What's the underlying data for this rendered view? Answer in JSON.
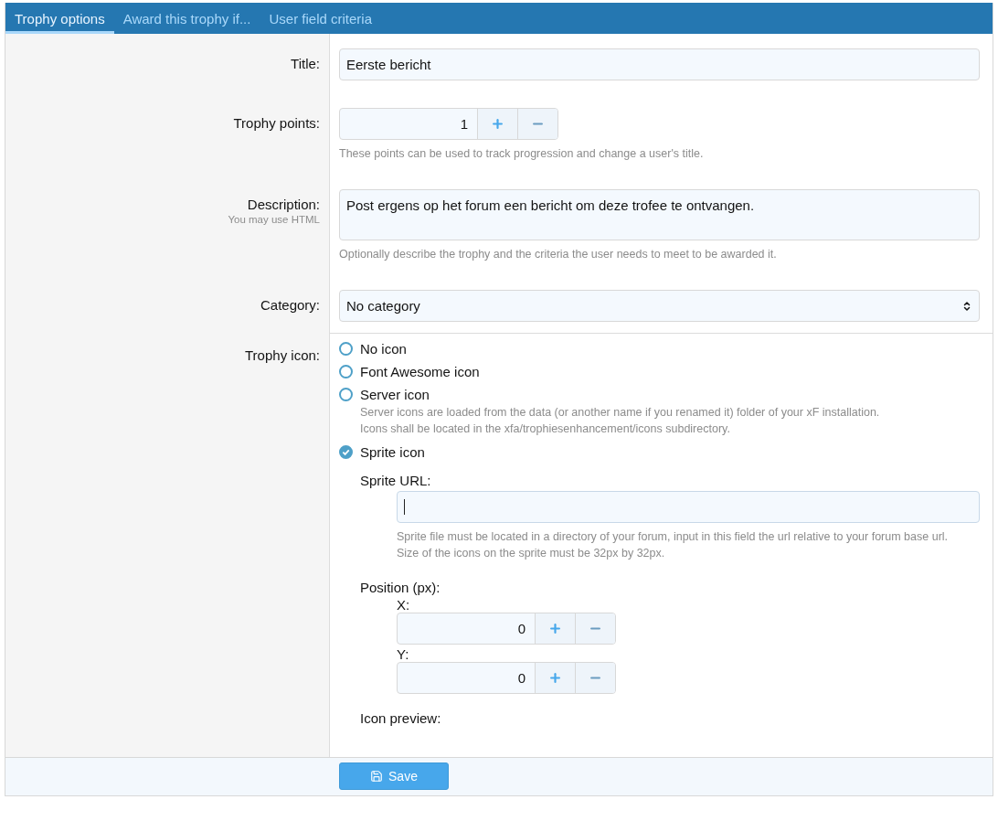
{
  "tabs": [
    {
      "label": "Trophy options",
      "selected": true
    },
    {
      "label": "Award this trophy if...",
      "selected": false
    },
    {
      "label": "User field criteria",
      "selected": false
    }
  ],
  "form": {
    "rows": [
      {
        "kind": "text",
        "label": "Title:",
        "value": "Eerste bericht"
      },
      {
        "kind": "spinner",
        "label": "Trophy points:",
        "value": "1",
        "hint": "These points can be used to track progression and change a user's title."
      },
      {
        "kind": "textarea",
        "label": "Description:",
        "sublabel": "You may use HTML",
        "value": "Post ergens op het forum een bericht om deze trofee te ontvangen.",
        "hint": "Optionally describe the trophy and the criteria the user needs to meet to be awarded it."
      },
      {
        "kind": "select",
        "label": "Category:",
        "value": "No category"
      },
      {
        "kind": "radio_group",
        "label": "Trophy icon:",
        "options": [
          {
            "label": "No icon",
            "selected": false
          },
          {
            "label": "Font Awesome icon",
            "selected": false
          },
          {
            "label": "Server icon",
            "selected": false,
            "hint": [
              "Server icons are loaded from the data (or another name if you renamed it) folder of your xF installation.",
              "Icons shall be located in the xfa/trophiesenhancement/icons subdirectory."
            ]
          },
          {
            "label": "Sprite icon",
            "selected": true,
            "sprite": {
              "url_label": "Sprite URL:",
              "url_focused": true,
              "url_hint": [
                "Sprite file must be located in a directory of your forum, input in this field the url relative to your forum base url.",
                "Size of the icons on the sprite must be 32px by 32px."
              ],
              "position_label": "Position (px):",
              "coords": [
                {
                  "label": "X:",
                  "value": "0"
                },
                {
                  "label": "Y:",
                  "value": "0"
                }
              ],
              "preview_label": "Icon preview:"
            }
          }
        ]
      }
    ]
  },
  "save_button": "Save"
}
